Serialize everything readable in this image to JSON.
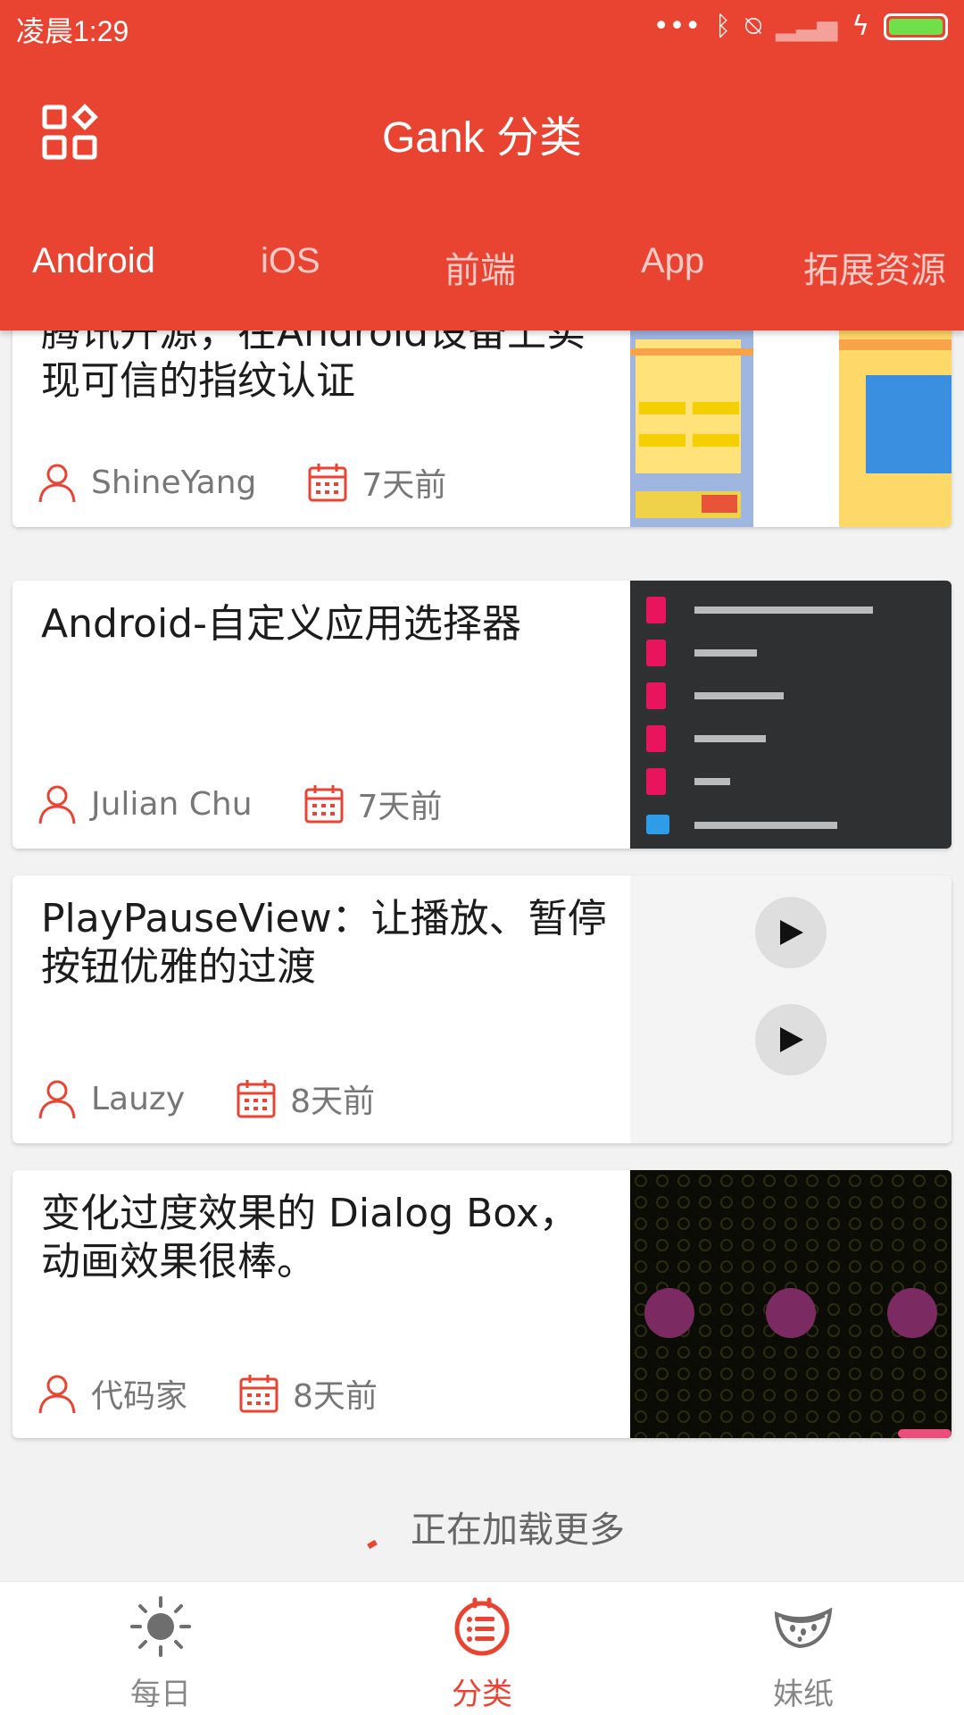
{
  "status_bar": {
    "time": "凌晨1:29",
    "icons": [
      "more-dots-icon",
      "bluetooth-icon",
      "vibrate-off-icon",
      "signal-icon",
      "charging-icon",
      "battery-icon"
    ]
  },
  "toolbar": {
    "title": "Gank 分类",
    "menu_icon": "grid-icon"
  },
  "tabs": [
    {
      "label": "Android",
      "active": true
    },
    {
      "label": "iOS",
      "active": false
    },
    {
      "label": "前端",
      "active": false
    },
    {
      "label": "App",
      "active": false
    },
    {
      "label": "拓展资源",
      "active": false
    }
  ],
  "cards": [
    {
      "title": "腾讯开源，在Android设备上实现可信的指纹认证",
      "author": "ShineYang",
      "date": "7天前"
    },
    {
      "title": "Android-自定义应用选择器",
      "author": "Julian Chu",
      "date": "7天前"
    },
    {
      "title": "PlayPauseView：让播放、暂停按钮优雅的过渡",
      "author": "Lauzy",
      "date": "8天前"
    },
    {
      "title": "变化过度效果的 Dialog Box，动画效果很棒。",
      "author": "代码家",
      "date": "8天前"
    }
  ],
  "loading_text": "正在加载更多",
  "bottom_nav": [
    {
      "label": "每日",
      "icon": "sun-icon",
      "active": false
    },
    {
      "label": "分类",
      "icon": "category-icon",
      "active": true
    },
    {
      "label": "妹纸",
      "icon": "watermelon-icon",
      "active": false
    }
  ],
  "colors": {
    "primary": "#e94332",
    "battery": "#6fe04a"
  }
}
